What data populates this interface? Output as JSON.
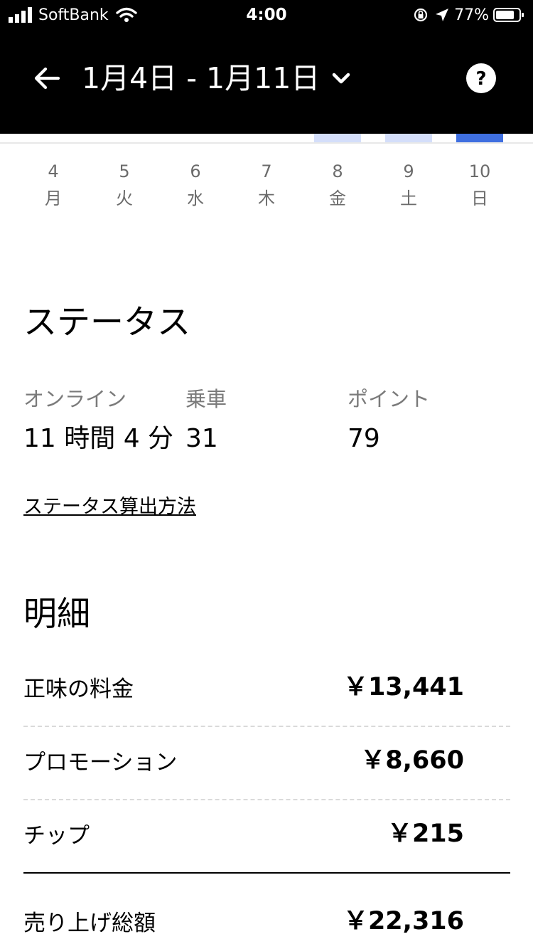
{
  "status_bar": {
    "carrier": "SoftBank",
    "time": "4:00",
    "battery": "77%"
  },
  "header": {
    "date_range": "1月4日 - 1月11日",
    "icons": [
      "back-arrow-icon",
      "chevron-down-icon",
      "help-icon"
    ]
  },
  "chart": {
    "bar_colors": [
      "#d4defa",
      "#d4defa",
      "#3f6fe0"
    ],
    "days": [
      {
        "num": "4",
        "weekday": "月"
      },
      {
        "num": "5",
        "weekday": "火"
      },
      {
        "num": "6",
        "weekday": "水"
      },
      {
        "num": "7",
        "weekday": "木"
      },
      {
        "num": "8",
        "weekday": "金"
      },
      {
        "num": "9",
        "weekday": "土"
      },
      {
        "num": "10",
        "weekday": "日"
      }
    ]
  },
  "status": {
    "title": "ステータス",
    "stats": [
      {
        "label": "オンライン",
        "value": "11 時間 4 分"
      },
      {
        "label": "乗車",
        "value": "31"
      },
      {
        "label": "ポイント",
        "value": "79"
      }
    ],
    "calc_link": "ステータス算出方法"
  },
  "breakdown": {
    "title": "明細",
    "rows": [
      {
        "label": "正味の料金",
        "amount": "￥13,441"
      },
      {
        "label": "プロモーション",
        "amount": "￥8,660"
      },
      {
        "label": "チップ",
        "amount": "￥215"
      }
    ],
    "total": {
      "label": "売り上げ総額",
      "amount": "￥22,316"
    }
  }
}
